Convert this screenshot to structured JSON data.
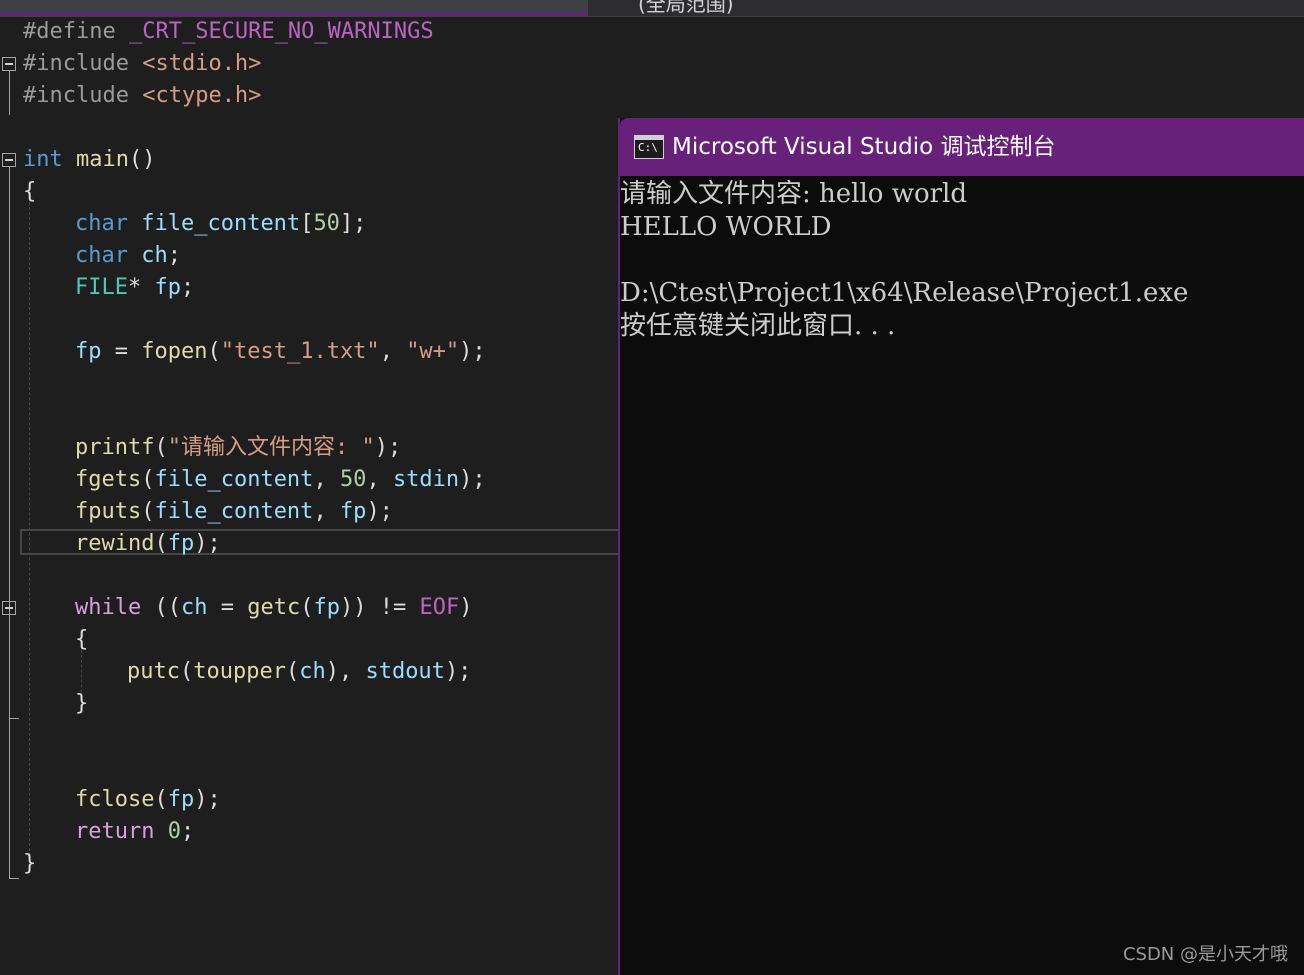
{
  "scope_label": "(全局范围)",
  "code_lines": [
    {
      "row": 0,
      "indent": 0,
      "tokens": [
        {
          "t": "#define",
          "c": "p"
        },
        {
          "t": " "
        },
        {
          "t": "_CRT_SECURE_NO_WARNINGS",
          "c": "m"
        }
      ]
    },
    {
      "row": 1,
      "indent": 0,
      "tokens": [
        {
          "t": "#include",
          "c": "p"
        },
        {
          "t": " "
        },
        {
          "t": "<stdio.h>",
          "c": "s"
        }
      ]
    },
    {
      "row": 2,
      "indent": 0,
      "tokens": [
        {
          "t": "#include",
          "c": "p"
        },
        {
          "t": " "
        },
        {
          "t": "<ctype.h>",
          "c": "s"
        }
      ]
    },
    {
      "row": 4,
      "indent": 0,
      "tokens": [
        {
          "t": "int",
          "c": "k"
        },
        {
          "t": " "
        },
        {
          "t": "main",
          "c": "f"
        },
        {
          "t": "()"
        }
      ]
    },
    {
      "row": 5,
      "indent": 0,
      "tokens": [
        {
          "t": "{"
        }
      ]
    },
    {
      "row": 6,
      "indent": 1,
      "tokens": [
        {
          "t": "char",
          "c": "k"
        },
        {
          "t": " "
        },
        {
          "t": "file_content",
          "c": "v"
        },
        {
          "t": "["
        },
        {
          "t": "50",
          "c": "n"
        },
        {
          "t": "];"
        }
      ]
    },
    {
      "row": 7,
      "indent": 1,
      "tokens": [
        {
          "t": "char",
          "c": "k"
        },
        {
          "t": " "
        },
        {
          "t": "ch",
          "c": "v"
        },
        {
          "t": ";"
        }
      ]
    },
    {
      "row": 8,
      "indent": 1,
      "tokens": [
        {
          "t": "FILE",
          "c": "t"
        },
        {
          "t": "* "
        },
        {
          "t": "fp",
          "c": "v"
        },
        {
          "t": ";"
        }
      ]
    },
    {
      "row": 10,
      "indent": 1,
      "tokens": [
        {
          "t": "fp",
          "c": "v"
        },
        {
          "t": " = "
        },
        {
          "t": "fopen",
          "c": "f"
        },
        {
          "t": "("
        },
        {
          "t": "\"test_1.txt\"",
          "c": "s"
        },
        {
          "t": ", "
        },
        {
          "t": "\"w+\"",
          "c": "s"
        },
        {
          "t": ");"
        }
      ]
    },
    {
      "row": 13,
      "indent": 1,
      "tokens": [
        {
          "t": "printf",
          "c": "f"
        },
        {
          "t": "("
        },
        {
          "t": "\"请输入文件内容: \"",
          "c": "s"
        },
        {
          "t": ");"
        }
      ]
    },
    {
      "row": 14,
      "indent": 1,
      "tokens": [
        {
          "t": "fgets",
          "c": "f"
        },
        {
          "t": "("
        },
        {
          "t": "file_content",
          "c": "v"
        },
        {
          "t": ", "
        },
        {
          "t": "50",
          "c": "n"
        },
        {
          "t": ", "
        },
        {
          "t": "stdin",
          "c": "v"
        },
        {
          "t": ");"
        }
      ]
    },
    {
      "row": 15,
      "indent": 1,
      "tokens": [
        {
          "t": "fputs",
          "c": "f"
        },
        {
          "t": "("
        },
        {
          "t": "file_content",
          "c": "v"
        },
        {
          "t": ", "
        },
        {
          "t": "fp",
          "c": "v"
        },
        {
          "t": ");"
        }
      ]
    },
    {
      "row": 16,
      "indent": 1,
      "tokens": [
        {
          "t": "rewind",
          "c": "f"
        },
        {
          "t": "("
        },
        {
          "t": "fp",
          "c": "v"
        },
        {
          "t": ");"
        }
      ]
    },
    {
      "row": 18,
      "indent": 1,
      "tokens": [
        {
          "t": "while",
          "c": "kw"
        },
        {
          "t": " (("
        },
        {
          "t": "ch",
          "c": "v"
        },
        {
          "t": " = "
        },
        {
          "t": "getc",
          "c": "f"
        },
        {
          "t": "("
        },
        {
          "t": "fp",
          "c": "v"
        },
        {
          "t": ")) != "
        },
        {
          "t": "EOF",
          "c": "m"
        },
        {
          "t": ")"
        }
      ]
    },
    {
      "row": 19,
      "indent": 1,
      "tokens": [
        {
          "t": "{"
        }
      ]
    },
    {
      "row": 20,
      "indent": 2,
      "tokens": [
        {
          "t": "putc",
          "c": "f"
        },
        {
          "t": "("
        },
        {
          "t": "toupper",
          "c": "f"
        },
        {
          "t": "("
        },
        {
          "t": "ch",
          "c": "v"
        },
        {
          "t": "), "
        },
        {
          "t": "stdout",
          "c": "v"
        },
        {
          "t": ");"
        }
      ]
    },
    {
      "row": 21,
      "indent": 1,
      "tokens": [
        {
          "t": "}"
        }
      ]
    },
    {
      "row": 24,
      "indent": 1,
      "tokens": [
        {
          "t": "fclose",
          "c": "f"
        },
        {
          "t": "("
        },
        {
          "t": "fp",
          "c": "v"
        },
        {
          "t": ");"
        }
      ]
    },
    {
      "row": 25,
      "indent": 1,
      "tokens": [
        {
          "t": "return",
          "c": "kw"
        },
        {
          "t": " "
        },
        {
          "t": "0",
          "c": "n"
        },
        {
          "t": ";"
        }
      ]
    },
    {
      "row": 26,
      "indent": 0,
      "tokens": [
        {
          "t": "}"
        }
      ]
    }
  ],
  "console": {
    "title": "Microsoft Visual Studio 调试控制台",
    "icon_text": "C:\\",
    "lines": [
      "请输入文件内容: hello world",
      "HELLO WORLD",
      "",
      "D:\\Ctest\\Project1\\x64\\Release\\Project1.exe",
      "按任意键关闭此窗口. . ."
    ]
  },
  "watermark": "CSDN @是小天才哦"
}
